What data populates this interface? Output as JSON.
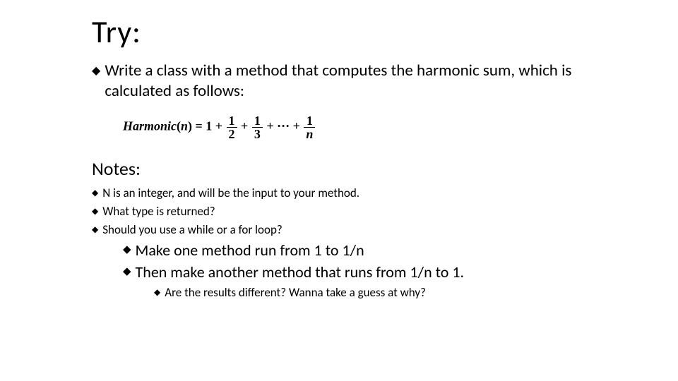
{
  "title": "Try:",
  "main_bullet": "Write a class with a method that computes the harmonic sum, which is calculated as follows:",
  "formula": {
    "lead": "Harmonic",
    "open": "(",
    "var": "n",
    "close": ")",
    "equals": " = 1 + ",
    "f1n": "1",
    "f1d": "2",
    "plus1": " + ",
    "f2n": "1",
    "f2d": "3",
    "plus2": " + ",
    "dots": "⋯",
    "plus3": " + ",
    "f3n": "1",
    "f3d": "n"
  },
  "notes_heading": "Notes:",
  "notes": [
    "N is an integer, and will be the input to your method.",
    "What type is returned?",
    "Should you use a while or a for loop?"
  ],
  "sub_methods": [
    "Make one method run from 1 to 1/n",
    "Then make another method that runs from 1/n to 1."
  ],
  "followup": "Are the results different?  Wanna take a guess at why?"
}
